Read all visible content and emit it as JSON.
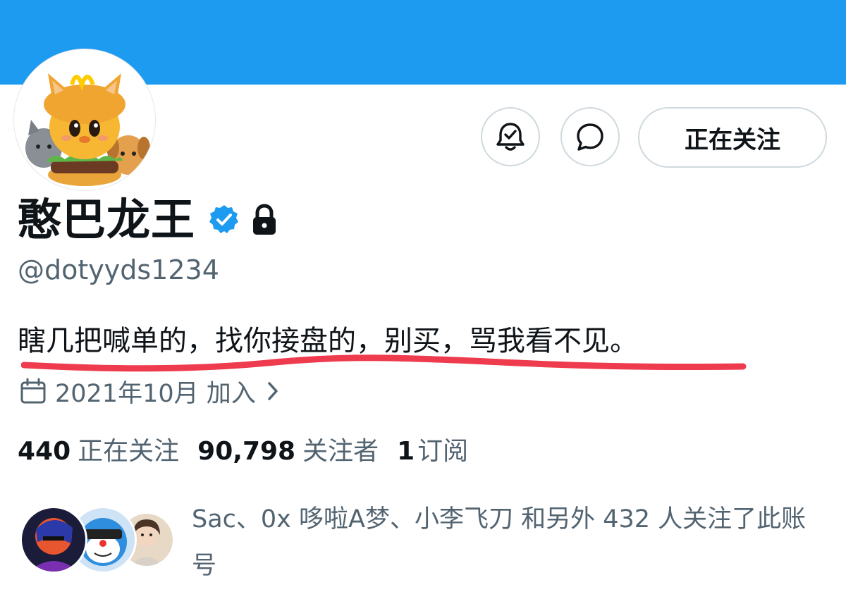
{
  "profile": {
    "display_name": "憨巴龙王",
    "handle": "@dotyyds1234",
    "bio": "瞎几把喊单的，找你接盘的，别买，骂我看不见。",
    "joined": "2021年10月 加入"
  },
  "actions": {
    "follow_label": "正在关注"
  },
  "stats": {
    "following_count": "440",
    "following_label": "正在关注",
    "followers_count": "90,798",
    "followers_label": "关注者",
    "subscriptions_count": "1",
    "subscriptions_label": "订阅"
  },
  "followed_by_text": "Sac、0x 哆啦A梦、小李飞刀 和另外 432 人关注了此账号",
  "colors": {
    "banner": "#1d9bf0",
    "verified": "#1d9bf0",
    "underline": "#ee3b4d",
    "secondary_text": "#536471"
  },
  "icons": {
    "bell": "bell-check-icon",
    "message": "message-bubble-icon",
    "verified": "verified-badge-icon",
    "lock": "lock-icon",
    "calendar": "calendar-icon",
    "chevron": "chevron-right-icon"
  }
}
